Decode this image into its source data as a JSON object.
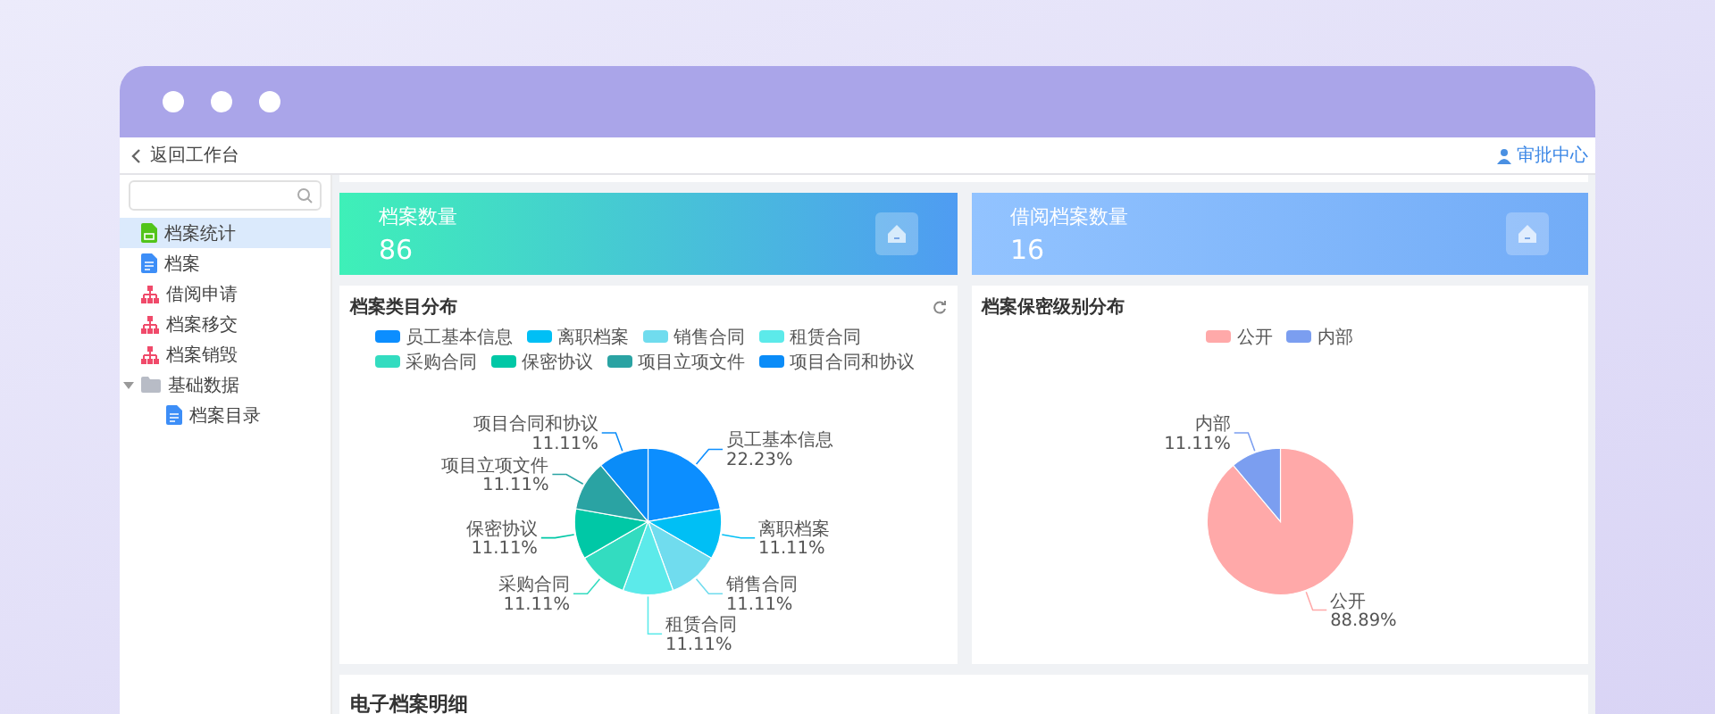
{
  "header": {
    "back": "返回工作台",
    "right_link": "审批中心"
  },
  "sidebar": {
    "items": [
      {
        "label": "档案统计",
        "kind": "stats",
        "selected": true
      },
      {
        "label": "档案",
        "kind": "doc",
        "selected": false
      },
      {
        "label": "借阅申请",
        "kind": "org",
        "selected": false
      },
      {
        "label": "档案移交",
        "kind": "org",
        "selected": false
      },
      {
        "label": "档案销毁",
        "kind": "org",
        "selected": false
      },
      {
        "label": "基础数据",
        "kind": "folder",
        "selected": false,
        "expanded": true,
        "children": [
          {
            "label": "档案目录",
            "kind": "doc",
            "selected": false
          }
        ]
      }
    ]
  },
  "stats": [
    {
      "title": "档案数量",
      "value": "86"
    },
    {
      "title": "借阅档案数量",
      "value": "16"
    }
  ],
  "charts": [
    {
      "title": "档案类目分布",
      "refresh": true,
      "legend": [
        {
          "label": "员工基本信息",
          "color": "#0c8eff"
        },
        {
          "label": "离职档案",
          "color": "#00bff5"
        },
        {
          "label": "销售合同",
          "color": "#70dcee"
        },
        {
          "label": "租赁合同",
          "color": "#5ceaea"
        },
        {
          "label": "采购合同",
          "color": "#33dcc0"
        },
        {
          "label": "保密协议",
          "color": "#00c8a6"
        },
        {
          "label": "项目立项文件",
          "color": "#2aa3a3"
        },
        {
          "label": "项目合同和协议",
          "color": "#0a8cf8"
        }
      ],
      "chart_data": {
        "type": "pie",
        "categories": [
          "员工基本信息",
          "离职档案",
          "销售合同",
          "租赁合同",
          "采购合同",
          "保密协议",
          "项目立项文件",
          "项目合同和协议"
        ],
        "series": [
          {
            "values": [
              22.23,
              11.11,
              11.11,
              11.11,
              11.11,
              11.11,
              11.11,
              11.11
            ]
          }
        ],
        "value_labels": [
          "22.23%",
          "11.11%",
          "11.11%",
          "11.11%",
          "11.11%",
          "11.11%",
          "11.11%",
          "11.11%"
        ]
      }
    },
    {
      "title": "档案保密级别分布",
      "refresh": false,
      "legend": [
        {
          "label": "公开",
          "color": "#ffa9a9"
        },
        {
          "label": "内部",
          "color": "#7b9ef0"
        }
      ],
      "chart_data": {
        "type": "pie",
        "categories": [
          "公开",
          "内部"
        ],
        "series": [
          {
            "values": [
              88.89,
              11.11
            ]
          }
        ],
        "value_labels": [
          "88.89%",
          "11.11%"
        ]
      }
    }
  ],
  "detail_card": {
    "title": "电子档案明细"
  }
}
